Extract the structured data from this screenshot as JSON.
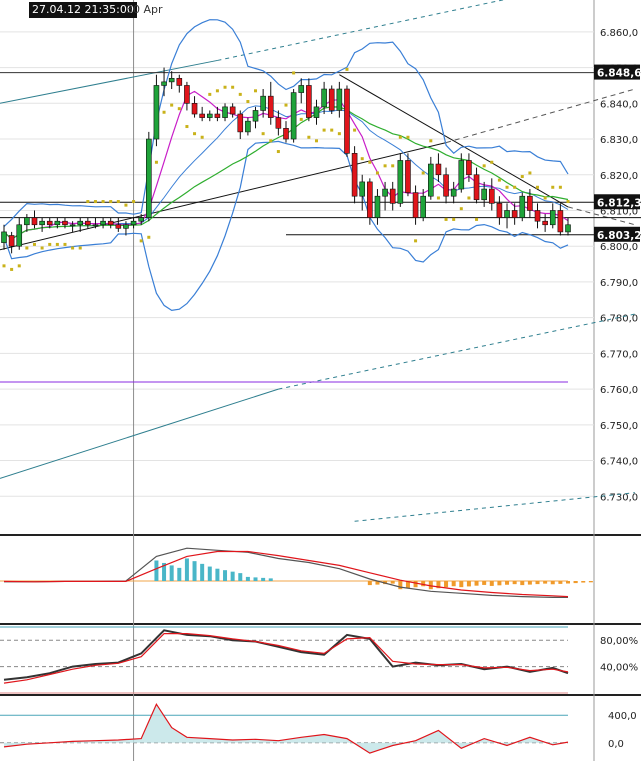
{
  "header": {
    "cursor_time": "27.04.12 21:35:00",
    "date_label": "30 Apr"
  },
  "colors": {
    "bull": "#1fa33a",
    "bear": "#e0151b",
    "bollinger": "#3a7fd6",
    "ma_fast": "#c81ec8",
    "ma_slow": "#2fae2f",
    "parabolic_sar": "#c9b21a",
    "trend_channel": "#2f7f8f",
    "level_line": "#8a2be2",
    "stoch_fill_up": "#f4b7b7",
    "stoch_fill_down": "#666666",
    "macd_pos": "#49b6c8",
    "macd_neg": "#f09a2a"
  },
  "chart_data": [
    {
      "type": "candlestick",
      "name": "price",
      "ylim": [
        6.72,
        6.865
      ],
      "y_ticks": [
        "6.860,0",
        "6.850,0",
        "6.840,0",
        "6.830,0",
        "6.820,0",
        "6.810,0",
        "6.800,0",
        "6.790,0",
        "6.780,0",
        "6.770,0",
        "6.760,0",
        "6.750,0",
        "6.740,0",
        "6.730,0"
      ],
      "y_tick_values": [
        6.86,
        6.85,
        6.84,
        6.83,
        6.82,
        6.81,
        6.8,
        6.79,
        6.78,
        6.77,
        6.76,
        6.75,
        6.74,
        6.73
      ],
      "price_labels": [
        {
          "text": "6.848,6",
          "value": 6.8486
        },
        {
          "text": "6.812,3",
          "value": 6.8123
        },
        {
          "text": "6.803,2",
          "value": 6.8032
        }
      ],
      "horizontal_levels": [
        6.8486,
        6.8123,
        6.808,
        6.8032,
        6.762
      ],
      "candles": [
        [
          6.801,
          6.806,
          6.799,
          6.804
        ],
        [
          6.803,
          6.804,
          6.798,
          6.8
        ],
        [
          6.8,
          6.808,
          6.799,
          6.806
        ],
        [
          6.806,
          6.809,
          6.804,
          6.808
        ],
        [
          6.808,
          6.81,
          6.805,
          6.806
        ],
        [
          6.806,
          6.808,
          6.804,
          6.807
        ],
        [
          6.807,
          6.808,
          6.805,
          6.806
        ],
        [
          6.806,
          6.808,
          6.805,
          6.807
        ],
        [
          6.807,
          6.808,
          6.805,
          6.806
        ],
        [
          6.806,
          6.807,
          6.804,
          6.806
        ],
        [
          6.806,
          6.808,
          6.804,
          6.807
        ],
        [
          6.807,
          6.808,
          6.805,
          6.806
        ],
        [
          6.806,
          6.808,
          6.805,
          6.806
        ],
        [
          6.806,
          6.808,
          6.805,
          6.807
        ],
        [
          6.807,
          6.808,
          6.805,
          6.806
        ],
        [
          6.806,
          6.808,
          6.804,
          6.805
        ],
        [
          6.805,
          6.807,
          6.803,
          6.806
        ],
        [
          6.806,
          6.808,
          6.805,
          6.807
        ],
        [
          6.807,
          6.809,
          6.806,
          6.808
        ],
        [
          6.808,
          6.832,
          6.807,
          6.83
        ],
        [
          6.83,
          6.848,
          6.828,
          6.845
        ],
        [
          6.845,
          6.85,
          6.842,
          6.846
        ],
        [
          6.846,
          6.849,
          6.844,
          6.847
        ],
        [
          6.847,
          6.848,
          6.843,
          6.845
        ],
        [
          6.845,
          6.846,
          6.838,
          6.84
        ],
        [
          6.84,
          6.842,
          6.836,
          6.837
        ],
        [
          6.837,
          6.839,
          6.835,
          6.836
        ],
        [
          6.836,
          6.838,
          6.835,
          6.837
        ],
        [
          6.837,
          6.839,
          6.835,
          6.836
        ],
        [
          6.836,
          6.84,
          6.835,
          6.839
        ],
        [
          6.839,
          6.84,
          6.836,
          6.837
        ],
        [
          6.837,
          6.838,
          6.83,
          6.832
        ],
        [
          6.832,
          6.836,
          6.831,
          6.835
        ],
        [
          6.835,
          6.839,
          6.833,
          6.838
        ],
        [
          6.838,
          6.844,
          6.836,
          6.842
        ],
        [
          6.842,
          6.846,
          6.834,
          6.836
        ],
        [
          6.836,
          6.838,
          6.831,
          6.833
        ],
        [
          6.833,
          6.835,
          6.829,
          6.83
        ],
        [
          6.83,
          6.844,
          6.829,
          6.843
        ],
        [
          6.843,
          6.847,
          6.84,
          6.845
        ],
        [
          6.845,
          6.847,
          6.835,
          6.836
        ],
        [
          6.836,
          6.841,
          6.834,
          6.839
        ],
        [
          6.839,
          6.846,
          6.837,
          6.844
        ],
        [
          6.844,
          6.845,
          6.837,
          6.838
        ],
        [
          6.838,
          6.846,
          6.836,
          6.844
        ],
        [
          6.844,
          6.845,
          6.825,
          6.826
        ],
        [
          6.826,
          6.828,
          6.812,
          6.814
        ],
        [
          6.814,
          6.82,
          6.81,
          6.818
        ],
        [
          6.818,
          6.819,
          6.806,
          6.808
        ],
        [
          6.808,
          6.816,
          6.806,
          6.814
        ],
        [
          6.814,
          6.818,
          6.81,
          6.816
        ],
        [
          6.816,
          6.818,
          6.81,
          6.812
        ],
        [
          6.812,
          6.826,
          6.811,
          6.824
        ],
        [
          6.824,
          6.826,
          6.814,
          6.815
        ],
        [
          6.815,
          6.817,
          6.806,
          6.808
        ],
        [
          6.808,
          6.816,
          6.807,
          6.814
        ],
        [
          6.814,
          6.825,
          6.813,
          6.823
        ],
        [
          6.823,
          6.826,
          6.818,
          6.82
        ],
        [
          6.82,
          6.822,
          6.812,
          6.814
        ],
        [
          6.814,
          6.818,
          6.812,
          6.816
        ],
        [
          6.816,
          6.826,
          6.815,
          6.824
        ],
        [
          6.824,
          6.826,
          6.818,
          6.82
        ],
        [
          6.82,
          6.822,
          6.812,
          6.813
        ],
        [
          6.813,
          6.818,
          6.811,
          6.816
        ],
        [
          6.816,
          6.819,
          6.81,
          6.812
        ],
        [
          6.812,
          6.814,
          6.806,
          6.808
        ],
        [
          6.808,
          6.812,
          6.805,
          6.81
        ],
        [
          6.81,
          6.812,
          6.806,
          6.808
        ],
        [
          6.808,
          6.815,
          6.807,
          6.814
        ],
        [
          6.814,
          6.816,
          6.808,
          6.81
        ],
        [
          6.81,
          6.812,
          6.805,
          6.807
        ],
        [
          6.807,
          6.809,
          6.804,
          6.806
        ],
        [
          6.806,
          6.812,
          6.805,
          6.81
        ],
        [
          6.81,
          6.812,
          6.803,
          6.804
        ],
        [
          6.804,
          6.808,
          6.803,
          6.806
        ]
      ]
    },
    {
      "type": "line",
      "name": "macd",
      "ylim": [
        -1,
        1
      ],
      "y_ticks": [],
      "x": [
        0,
        4,
        8,
        12,
        16,
        20,
        24,
        28,
        32,
        36,
        40,
        44,
        48,
        52,
        56,
        60,
        64,
        68,
        72,
        74
      ],
      "series": [
        {
          "values": [
            -0.02,
            -0.02,
            -0.01,
            -0.01,
            0.0,
            0.6,
            0.8,
            0.75,
            0.7,
            0.55,
            0.45,
            0.3,
            0.05,
            -0.15,
            -0.25,
            -0.3,
            -0.35,
            -0.38,
            -0.4,
            -0.4
          ]
        },
        {
          "values": [
            -0.01,
            -0.02,
            -0.01,
            -0.01,
            -0.01,
            0.3,
            0.6,
            0.72,
            0.72,
            0.62,
            0.5,
            0.38,
            0.2,
            0.02,
            -0.12,
            -0.22,
            -0.28,
            -0.33,
            -0.36,
            -0.38
          ]
        }
      ],
      "histogram": [
        0,
        0,
        0,
        0,
        0,
        0.5,
        0.55,
        0.3,
        0.1,
        0,
        0,
        0,
        -0.1,
        -0.2,
        -0.2,
        -0.15,
        -0.12,
        -0.1,
        -0.08,
        -0.05
      ]
    },
    {
      "type": "line",
      "name": "stochastic",
      "ylim": [
        0,
        100
      ],
      "y_ticks": [
        "80,00%",
        "40,00%"
      ],
      "y_tick_values": [
        80,
        40
      ],
      "x": [
        0,
        3,
        6,
        9,
        12,
        15,
        18,
        21,
        24,
        27,
        30,
        33,
        36,
        39,
        42,
        45,
        48,
        51,
        54,
        57,
        60,
        63,
        66,
        69,
        72,
        74
      ],
      "series": [
        {
          "values": [
            20,
            24,
            30,
            40,
            44,
            46,
            60,
            95,
            88,
            86,
            80,
            78,
            70,
            62,
            58,
            88,
            82,
            40,
            46,
            42,
            44,
            36,
            40,
            32,
            38,
            30
          ]
        },
        {
          "values": [
            15,
            20,
            28,
            36,
            42,
            45,
            55,
            90,
            90,
            87,
            82,
            78,
            72,
            64,
            60,
            82,
            84,
            48,
            44,
            43,
            43,
            38,
            39,
            34,
            36,
            32
          ]
        }
      ]
    },
    {
      "type": "line",
      "name": "cci",
      "ylim": [
        -250,
        650
      ],
      "y_ticks": [
        "400,0",
        "0,0"
      ],
      "y_tick_values": [
        400,
        0
      ],
      "x": [
        0,
        3,
        6,
        9,
        12,
        15,
        18,
        20,
        22,
        24,
        27,
        30,
        33,
        36,
        39,
        42,
        45,
        48,
        51,
        54,
        57,
        60,
        63,
        66,
        69,
        72,
        74
      ],
      "series": [
        {
          "values": [
            -60,
            -20,
            0,
            20,
            30,
            40,
            60,
            560,
            220,
            80,
            60,
            40,
            50,
            30,
            80,
            120,
            60,
            -150,
            -40,
            30,
            180,
            -80,
            60,
            -40,
            80,
            -30,
            10
          ]
        }
      ]
    }
  ]
}
